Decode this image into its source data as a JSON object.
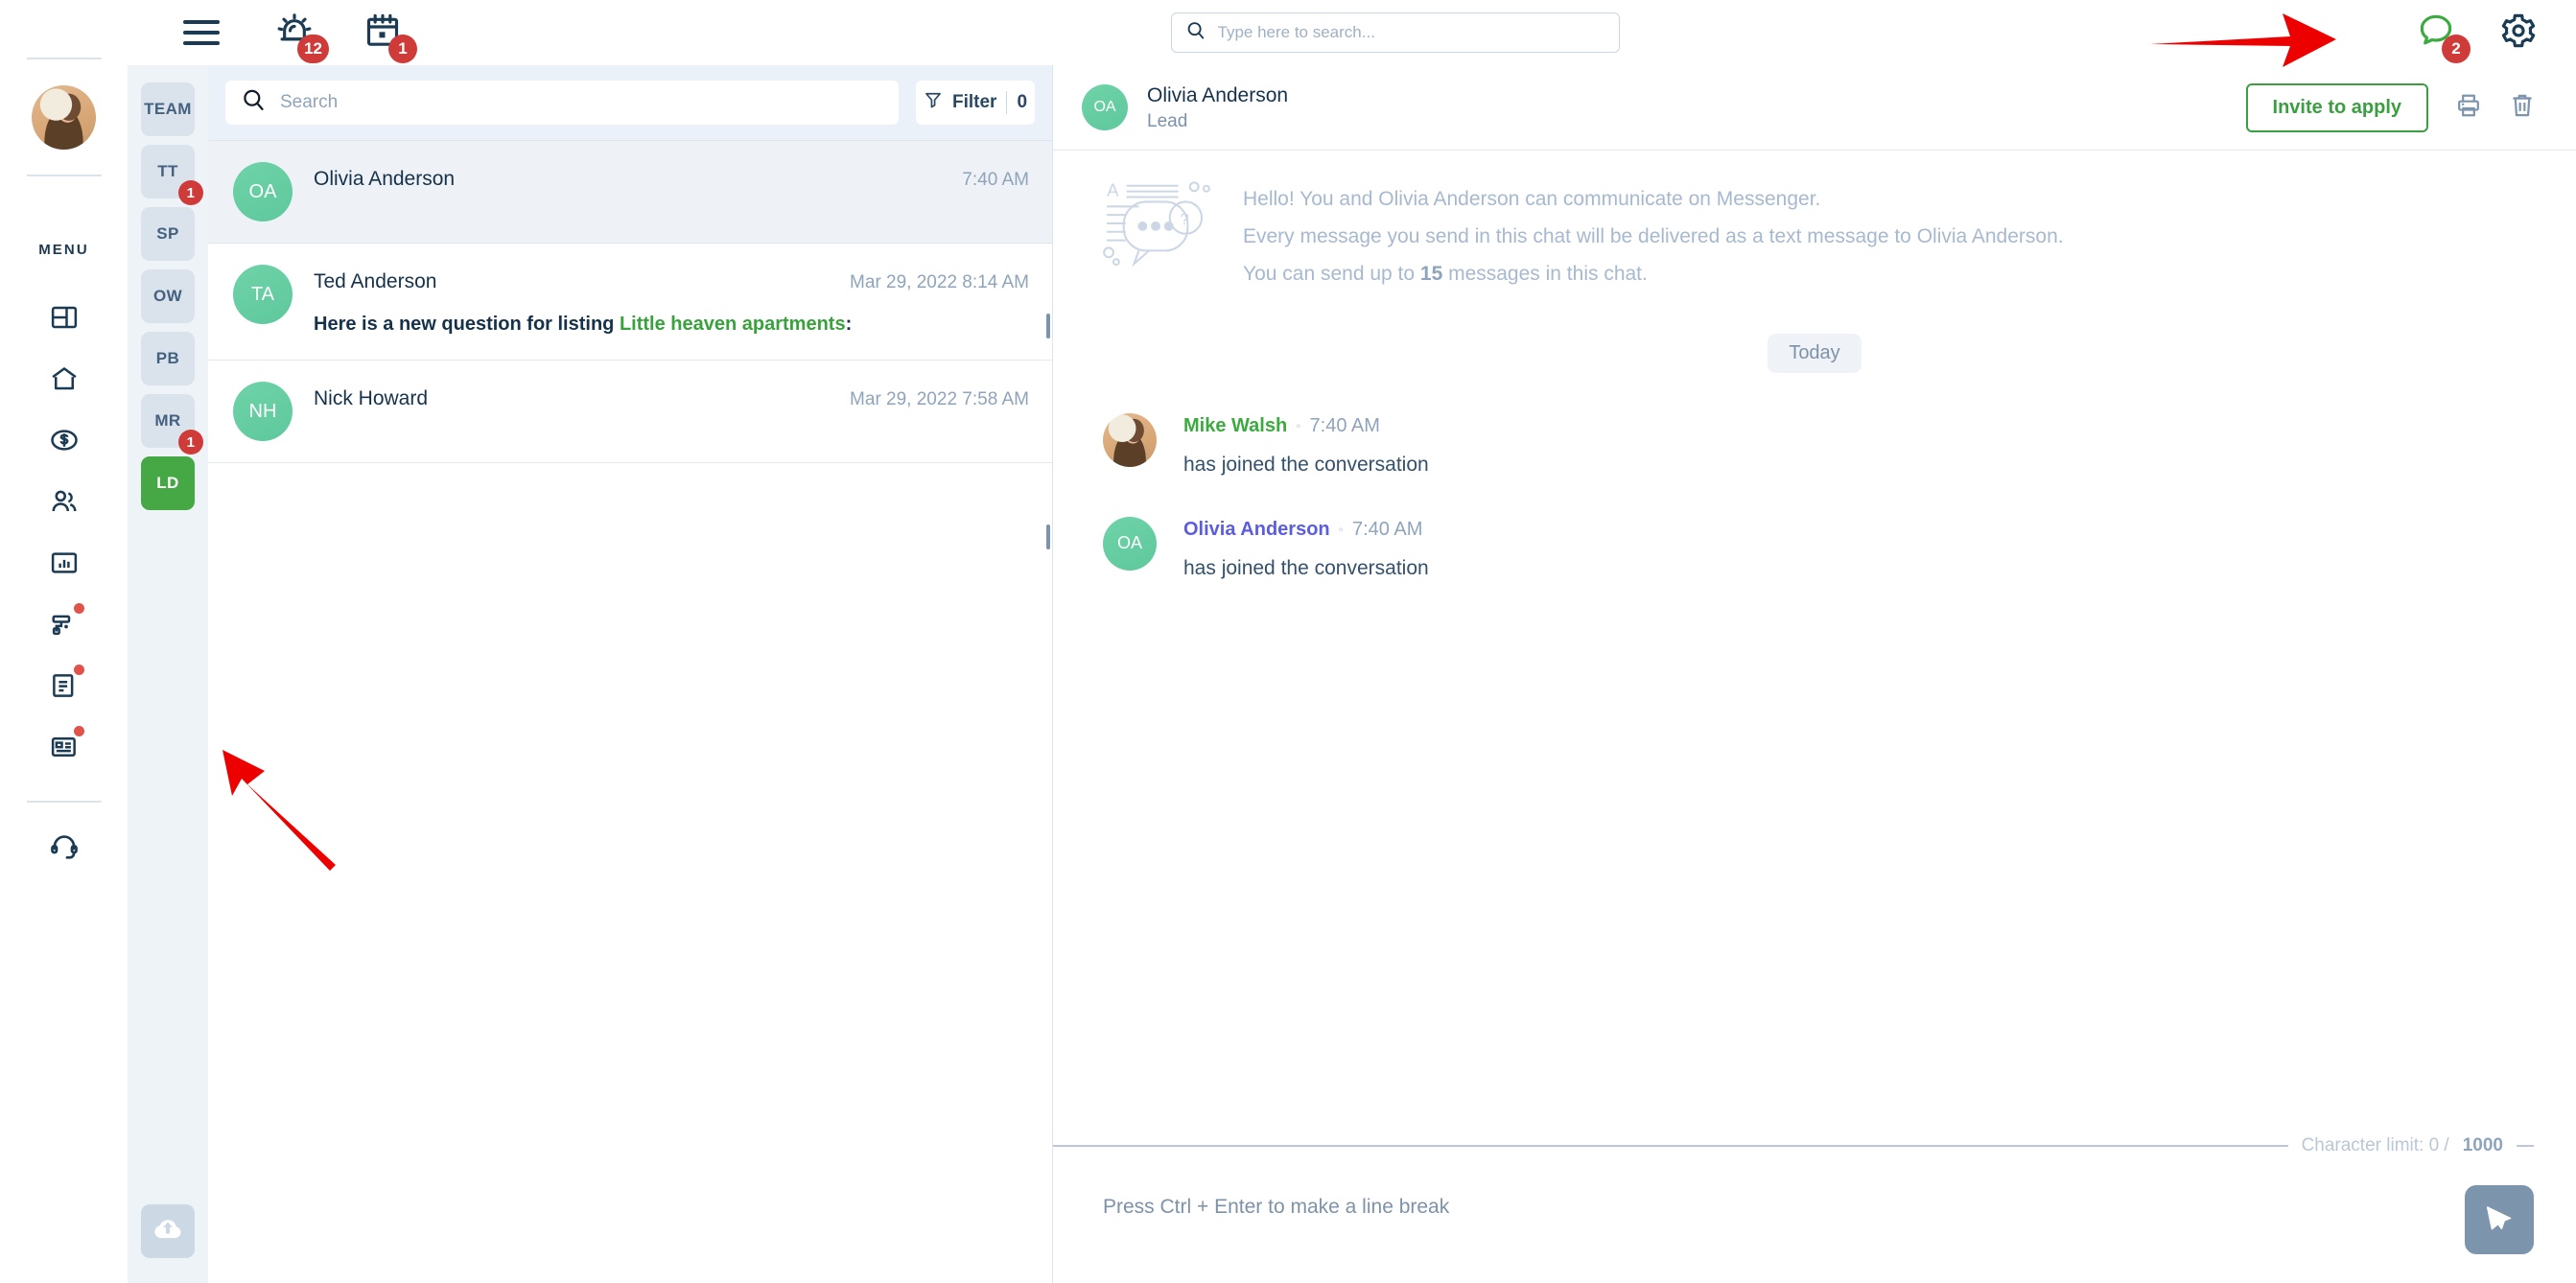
{
  "topbar": {
    "menu_icon": "hamburger-icon",
    "alarm_icon": "alarm-icon",
    "alarm_badge": "12",
    "calendar_icon": "calendar-icon",
    "calendar_badge": "1",
    "search_placeholder": "Type here to search...",
    "search_value": "",
    "chat_icon": "chat-bubble-icon",
    "chat_badge": "2",
    "settings_icon": "gear-icon",
    "colors": {
      "badge": "#cf3b38",
      "chat_green": "#3bab3f",
      "dark": "#1b3a54"
    }
  },
  "rail": {
    "menu_label": "MENU",
    "avatar_name": "user-avatar",
    "items": [
      {
        "name": "dashboard-icon",
        "dot": false
      },
      {
        "name": "home-icon",
        "dot": false
      },
      {
        "name": "dollar-coin-icon",
        "dot": false
      },
      {
        "name": "people-icon",
        "dot": false
      },
      {
        "name": "reports-icon",
        "dot": false
      },
      {
        "name": "maintenance-roller-icon",
        "dot": true
      },
      {
        "name": "document-icon",
        "dot": true
      },
      {
        "name": "id-card-icon",
        "dot": true
      }
    ],
    "support_icon": "headset-support-icon"
  },
  "team_strip": {
    "items": [
      {
        "label": "TEAM",
        "badge": "",
        "active": false
      },
      {
        "label": "TT",
        "badge": "1",
        "active": false
      },
      {
        "label": "SP",
        "badge": "",
        "active": false
      },
      {
        "label": "OW",
        "badge": "",
        "active": false
      },
      {
        "label": "PB",
        "badge": "",
        "active": false
      },
      {
        "label": "MR",
        "badge": "1",
        "active": false
      },
      {
        "label": "LD",
        "badge": "",
        "active": true
      }
    ],
    "upload_icon": "cloud-upload-icon",
    "active_color": "#45a845"
  },
  "conversation_list": {
    "search_placeholder": "Search",
    "search_value": "",
    "filter_label": "Filter",
    "filter_count": "0",
    "rows": [
      {
        "initials": "OA",
        "name": "Olivia Anderson",
        "time": "7:40 AM",
        "snippet": "",
        "snippet_listing": "",
        "selected": true
      },
      {
        "initials": "TA",
        "name": "Ted Anderson",
        "time": "Mar 29, 2022 8:14 AM",
        "snippet": "Here is a new question for listing ",
        "snippet_listing": "Little heaven apartments",
        "snippet_tail": ":",
        "selected": false
      },
      {
        "initials": "NH",
        "name": "Nick Howard",
        "time": "Mar 29, 2022 7:58 AM",
        "snippet": "",
        "snippet_listing": "",
        "selected": false
      }
    ]
  },
  "chat": {
    "header": {
      "initials": "OA",
      "name": "Olivia Anderson",
      "role": "Lead",
      "invite_label": "Invite to apply",
      "print_icon": "print-icon",
      "delete_icon": "trash-icon"
    },
    "notice": {
      "icon": "messenger-illustration-icon",
      "line1": "Hello! You and Olivia Anderson can communicate on Messenger.",
      "line2": "Every message you send in this chat will be delivered as a text message to Olivia Anderson.",
      "line3_pre": "You can send up to ",
      "line3_count": "15",
      "line3_post": " messages in this chat."
    },
    "day_divider": "Today",
    "messages": [
      {
        "author": "Mike Walsh",
        "author_color": "green",
        "time": "7:40 AM",
        "text": "has joined the conversation",
        "avatar_type": "photo",
        "initials": ""
      },
      {
        "author": "Olivia Anderson",
        "author_color": "purple",
        "time": "7:40 AM",
        "text": "has joined the conversation",
        "avatar_type": "initials",
        "initials": "OA"
      }
    ],
    "composer": {
      "char_limit_label": "Character limit: 0 / ",
      "char_limit_max": "1000",
      "placeholder": "Press Ctrl + Enter to make a line break",
      "value": "",
      "send_icon": "send-icon"
    }
  }
}
